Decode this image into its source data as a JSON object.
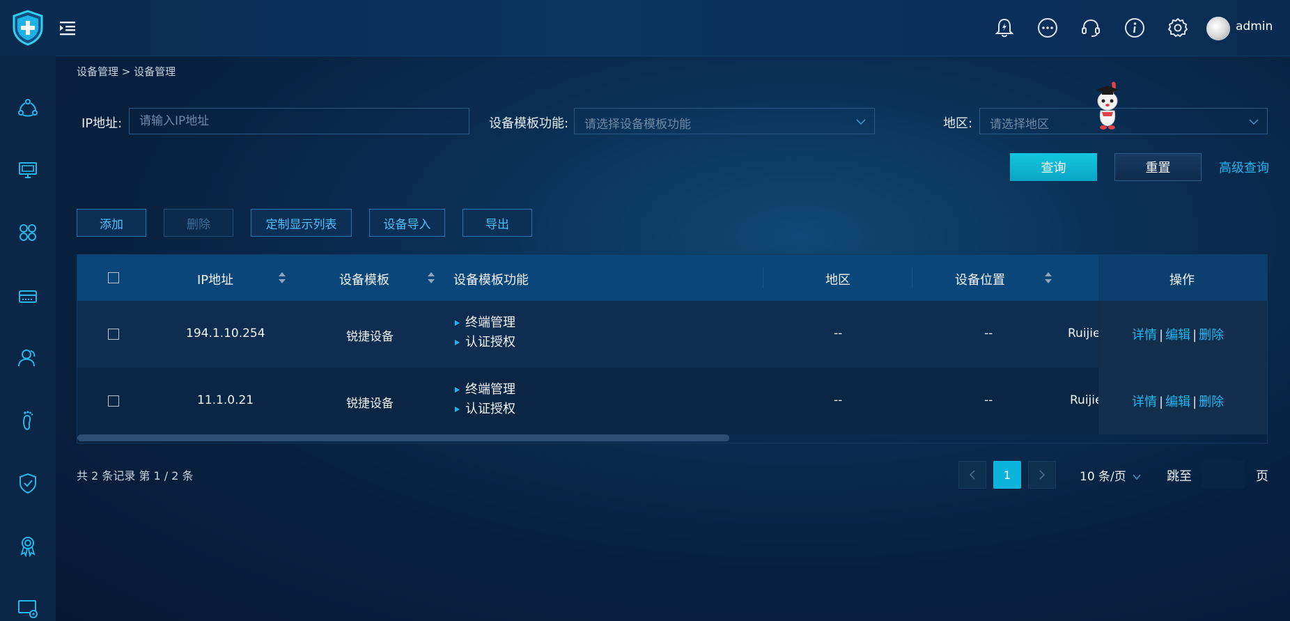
{
  "header": {
    "username": "admin"
  },
  "breadcrumb": "设备管理 > 设备管理",
  "filters": {
    "ip_label": "IP地址:",
    "ip_placeholder": "请输入IP地址",
    "template_func_label": "设备模板功能:",
    "template_func_placeholder": "请选择设备模板功能",
    "region_label": "地区:",
    "region_placeholder": "请选择地区"
  },
  "actions": {
    "query": "查询",
    "reset": "重置",
    "advanced": "高级查询"
  },
  "toolbar": {
    "add": "添加",
    "delete": "删除",
    "custom_columns": "定制显示列表",
    "import": "设备导入",
    "export": "导出"
  },
  "table": {
    "columns": [
      "IP地址",
      "设备模板",
      "设备模板功能",
      "地区",
      "设备位置",
      "操作"
    ],
    "rows": [
      {
        "ip": "194.1.10.254",
        "template": "锐捷设备",
        "functions": [
          "终端管理",
          "认证授权"
        ],
        "region": "--",
        "location": "--",
        "extra": "Ruijie"
      },
      {
        "ip": "11.1.0.21",
        "template": "锐捷设备",
        "functions": [
          "终端管理",
          "认证授权"
        ],
        "region": "--",
        "location": "--",
        "extra": "Ruijie"
      }
    ],
    "row_actions": {
      "detail": "详情",
      "edit": "编辑",
      "delete": "删除",
      "separator": "|"
    }
  },
  "pagination": {
    "summary": "共 2 条记录 第 1 / 2 条",
    "current_page": "1",
    "page_size": "10 条/页",
    "jump_label": "跳至",
    "page_unit": "页"
  },
  "colors": {
    "accent": "#1fb6ee",
    "primary_button": "#0aa6c7",
    "header_row": "#0b467a"
  }
}
